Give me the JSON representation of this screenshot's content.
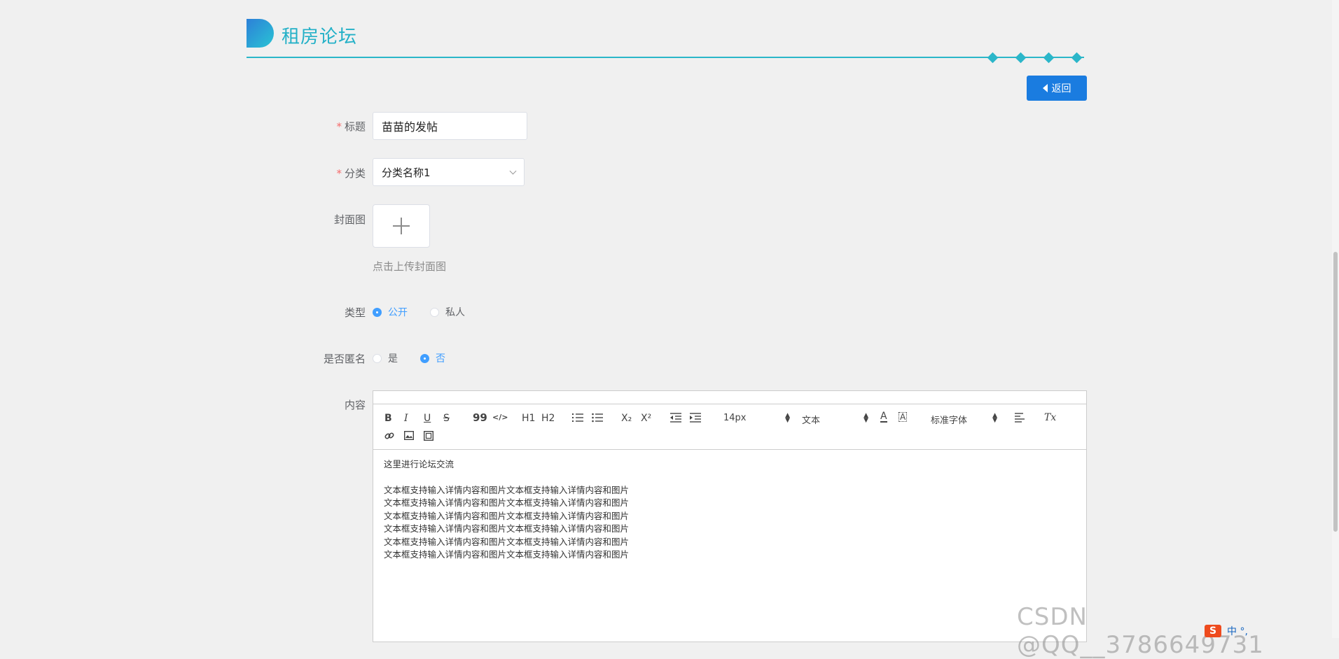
{
  "header": {
    "title": "租房论坛",
    "back_label": "返回"
  },
  "form": {
    "title_label": "标题",
    "title_value": "苗苗的发帖",
    "category_label": "分类",
    "category_value": "分类名称1",
    "cover_label": "封面图",
    "cover_hint": "点击上传封面图",
    "type_label": "类型",
    "type_options": [
      "公开",
      "私人"
    ],
    "type_selected": "公开",
    "anon_label": "是否匿名",
    "anon_options": [
      "是",
      "否"
    ],
    "anon_selected": "否",
    "content_label": "内容"
  },
  "editor": {
    "size_value": "14px",
    "header_value": "文本",
    "font_value": "标准字体",
    "intro": "这里进行论坛交流",
    "lines": [
      "文本框支持输入详情内容和图片文本框支持输入详情内容和图片",
      "文本框支持输入详情内容和图片文本框支持输入详情内容和图片",
      "文本框支持输入详情内容和图片文本框支持输入详情内容和图片",
      "文本框支持输入详情内容和图片文本框支持输入详情内容和图片",
      "文本框支持输入详情内容和图片文本框支持输入详情内容和图片",
      "文本框支持输入详情内容和图片文本框支持输入详情内容和图片"
    ],
    "toolbar": {
      "bold": "B",
      "italic": "I",
      "underline": "U",
      "strike": "S",
      "quote": "99",
      "code": "</>",
      "h1": "H1",
      "h2": "H2",
      "sub": "X₂",
      "sup": "X²",
      "color": "A",
      "background": "A",
      "clean": "Tx"
    }
  },
  "overlay": {
    "watermark": "CSDN @QQ__3786649731",
    "ime_logo": "S",
    "ime_mode": "中 °,"
  },
  "colors": {
    "accent": "#23b0c7",
    "primary": "#1a7ce0",
    "radio_on": "#409eff",
    "required": "#f56c6c"
  }
}
